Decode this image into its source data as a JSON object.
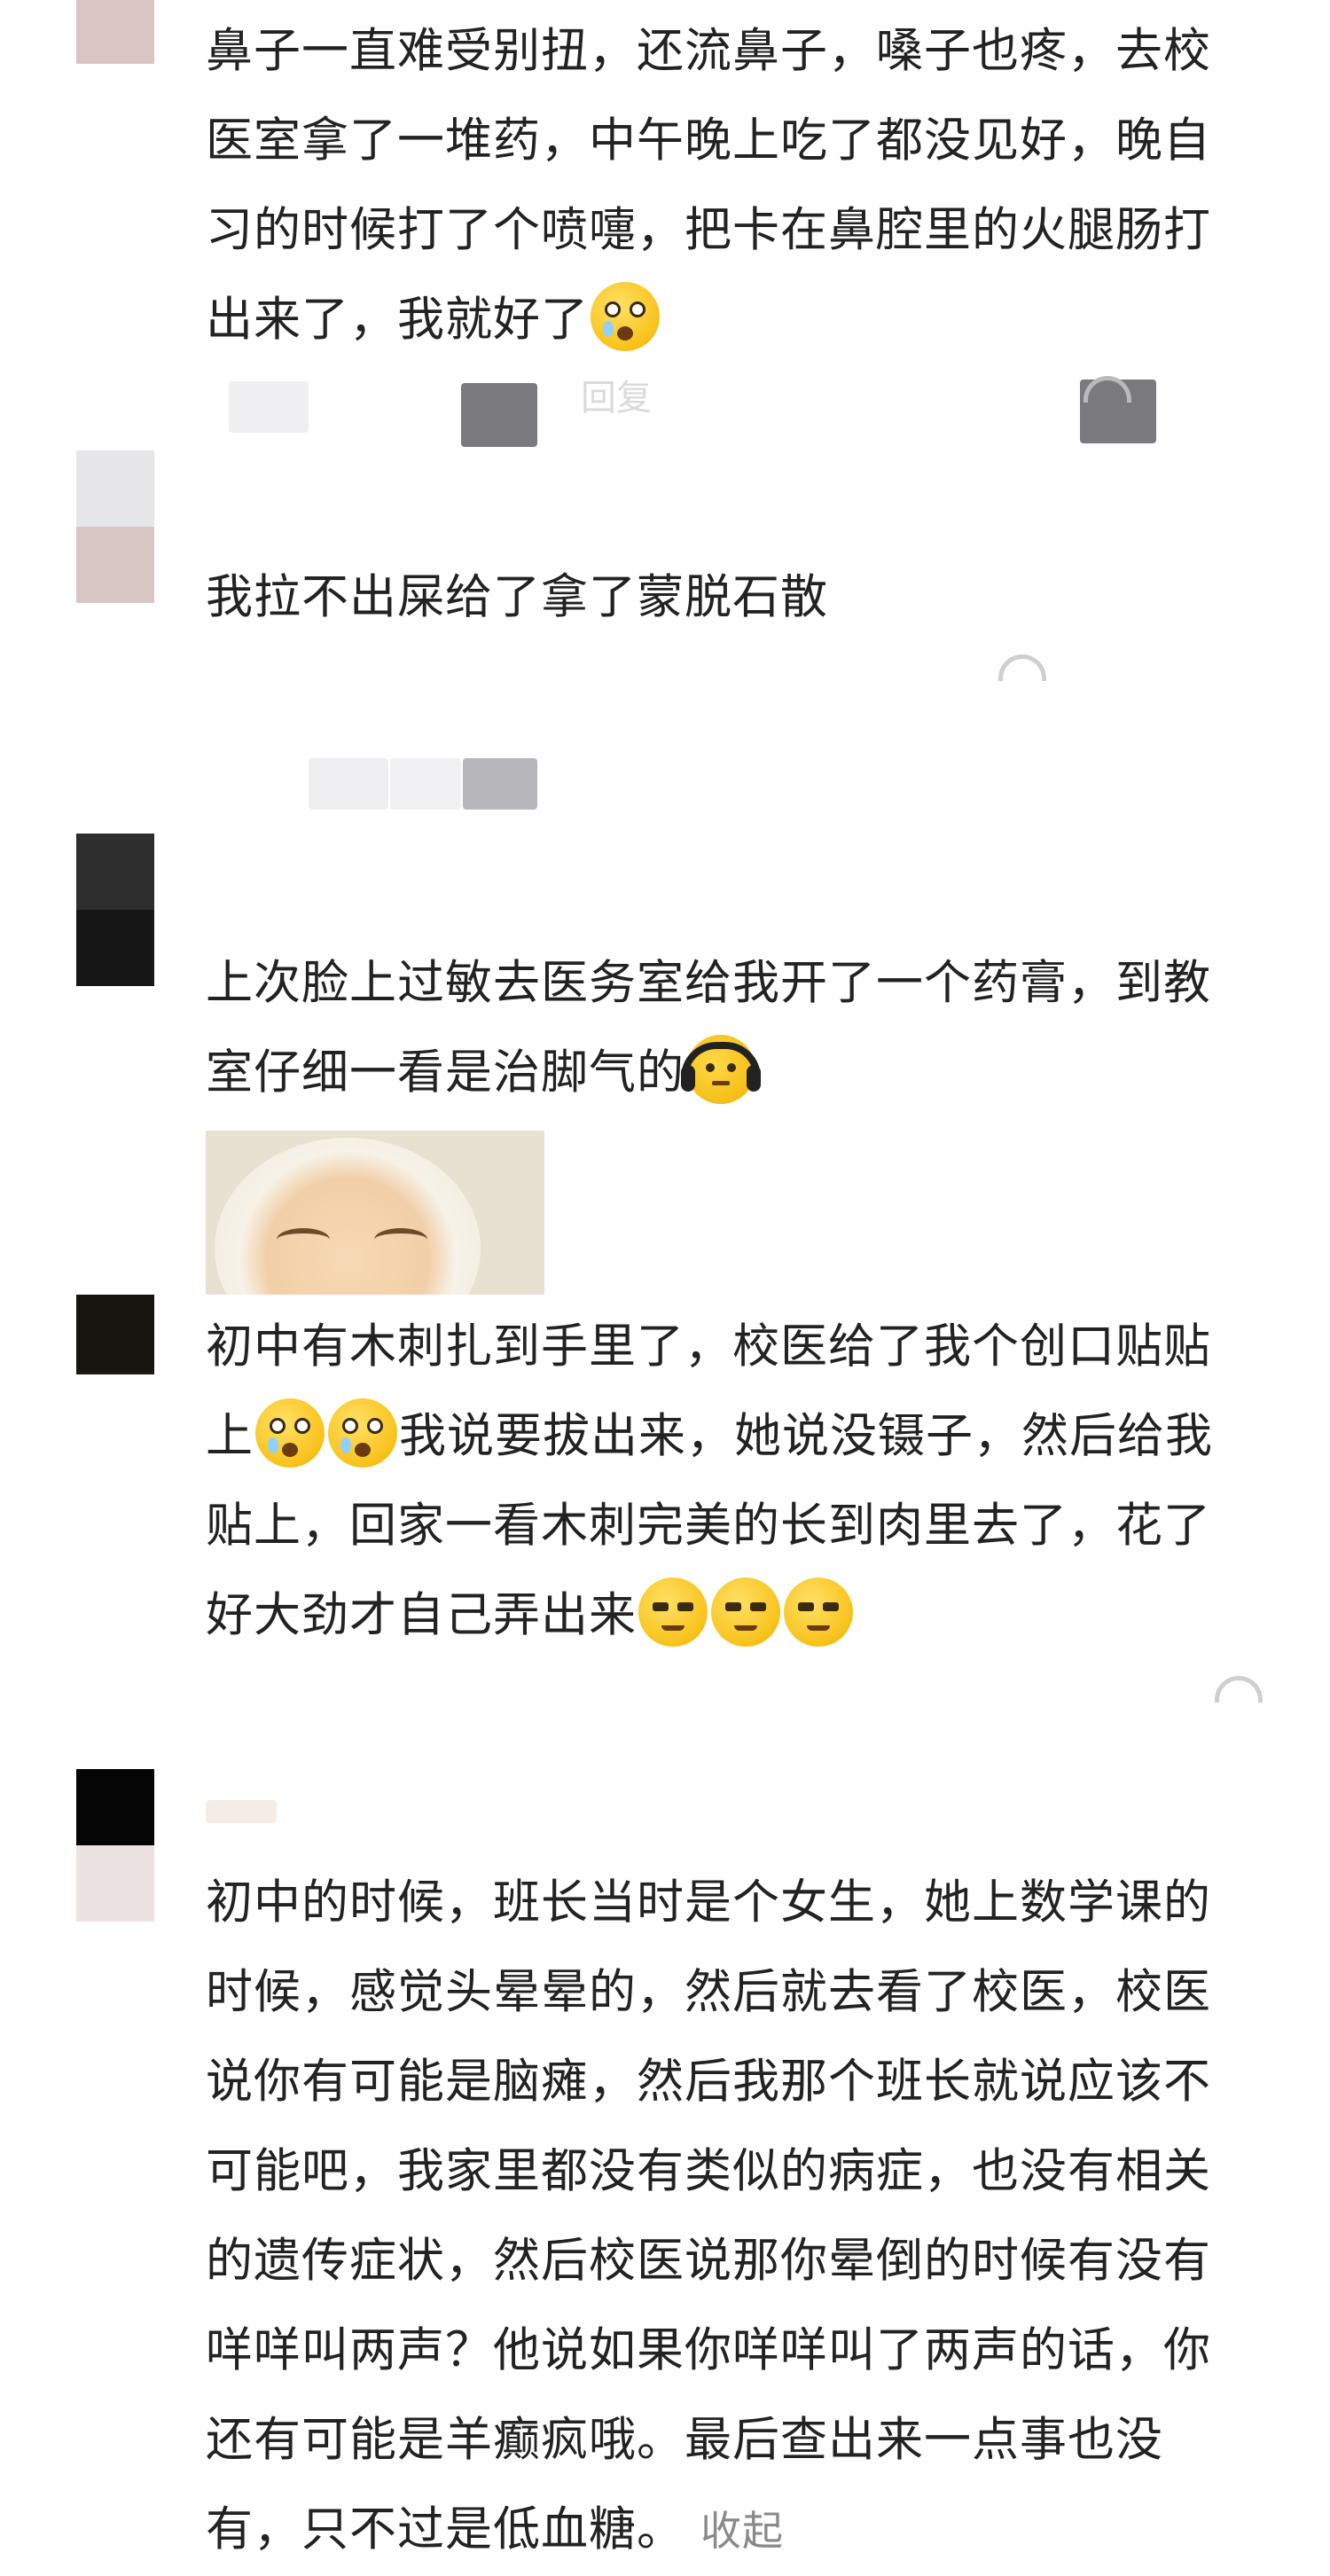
{
  "comments": [
    {
      "id": "c1",
      "lines": [
        "鼻子一直难受别扭，还流鼻子，嗓子也疼，去校",
        "医室拿了一堆药，中午晚上吃了都没见好，晚自",
        "习的时候打了个喷嚏，把卡在鼻腔里的火腿肠打",
        "出来了，我就好了"
      ],
      "emojis": [
        "shocked-face"
      ],
      "action_faint": "回复"
    },
    {
      "id": "c2",
      "lines": [
        "我拉不出屎给了拿了蒙脱石散"
      ]
    },
    {
      "id": "c3",
      "lines": [
        "上次脸上过敏去医务室给我开了一个药膏，到教",
        "室仔细一看是治脚气的"
      ],
      "emojis": [
        "headphones-face"
      ],
      "has_sticker": true
    },
    {
      "id": "c4",
      "lines": [
        "初中有木刺扎到手里了，校医给了我个创口贴贴",
        "上",
        "我说要拔出来，她说没镊子，然后给我",
        "贴上，回家一看木刺完美的长到肉里去了，花了",
        "好大劲才自己弄出来"
      ],
      "emojis": [
        "shocked-face",
        "shocked-face",
        "smug-face",
        "smug-face",
        "smug-face"
      ]
    },
    {
      "id": "c5",
      "lines": [
        "初中的时候，班长当时是个女生，她上数学课的",
        "时候，感觉头晕晕的，然后就去看了校医，校医",
        "说你有可能是脑瘫，然后我那个班长就说应该不",
        "可能吧，我家里都没有类似的病症，也没有相关",
        "的遗传症状，然后校医说那你晕倒的时候有没有",
        "咩咩叫两声？他说如果你咩咩叫了两声的话，你",
        "还有可能是羊癫疯哦。最后查出来一点事也没",
        "有，只不过是低血糖。"
      ],
      "collapse_label": "收起"
    }
  ],
  "colors": {
    "text": "#222222",
    "muted": "#8a8a8a",
    "emoji": "#f8c21b"
  }
}
